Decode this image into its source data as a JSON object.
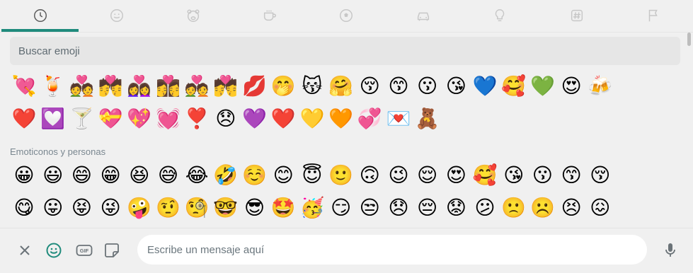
{
  "tabs": [
    {
      "name": "tab-recent",
      "icon": "clock-icon",
      "active": true
    },
    {
      "name": "tab-smileys",
      "icon": "smiley-icon",
      "active": false
    },
    {
      "name": "tab-animals",
      "icon": "bear-icon",
      "active": false
    },
    {
      "name": "tab-food",
      "icon": "cup-icon",
      "active": false
    },
    {
      "name": "tab-activity",
      "icon": "soccer-ball-icon",
      "active": false
    },
    {
      "name": "tab-travel",
      "icon": "car-icon",
      "active": false
    },
    {
      "name": "tab-objects",
      "icon": "lightbulb-icon",
      "active": false
    },
    {
      "name": "tab-symbols",
      "icon": "hashtag-icon",
      "active": false
    },
    {
      "name": "tab-flags",
      "icon": "flag-icon",
      "active": false
    }
  ],
  "accent_color": "#1f8b7c",
  "search": {
    "placeholder": "Buscar emoji"
  },
  "recent_emojis": [
    "💘",
    "🍹",
    "💑",
    "💏",
    "👩‍❤️‍👩",
    "👩‍❤️‍💋‍👩",
    "💑",
    "💏",
    "💋",
    "🤭",
    "😽",
    "🤗",
    "😚",
    "😙",
    "😗",
    "😘",
    "💙",
    "🥰",
    "💚",
    "😍",
    "🍻",
    "❤️",
    "💟",
    "🍸",
    "💝",
    "💖",
    "💓",
    "❣️",
    "😞",
    "💜",
    "❤️",
    "💛",
    "🧡",
    "💞",
    "💌",
    "🧸"
  ],
  "section_title": "Emoticonos y personas",
  "people_emojis": [
    "😀",
    "😃",
    "😄",
    "😁",
    "😆",
    "😅",
    "😂",
    "🤣",
    "☺️",
    "😊",
    "😇",
    "🙂",
    "🙃",
    "😉",
    "😌",
    "😍",
    "🥰",
    "😘",
    "😗",
    "😙",
    "😚",
    "😋",
    "😛",
    "😝",
    "😜",
    "🤪",
    "🤨",
    "🧐",
    "🤓",
    "😎",
    "🤩",
    "🥳",
    "😏",
    "😒",
    "😞",
    "😔",
    "😟",
    "😕",
    "🙁",
    "☹️",
    "😣",
    "😖"
  ],
  "bottom_bar": {
    "close_icon": "close-icon",
    "emoji_icon": "smiley-icon",
    "gif_label": "GIF",
    "sticker_icon": "sticker-icon",
    "message_placeholder": "Escribe un mensaje aquí",
    "mic_icon": "microphone-icon"
  }
}
